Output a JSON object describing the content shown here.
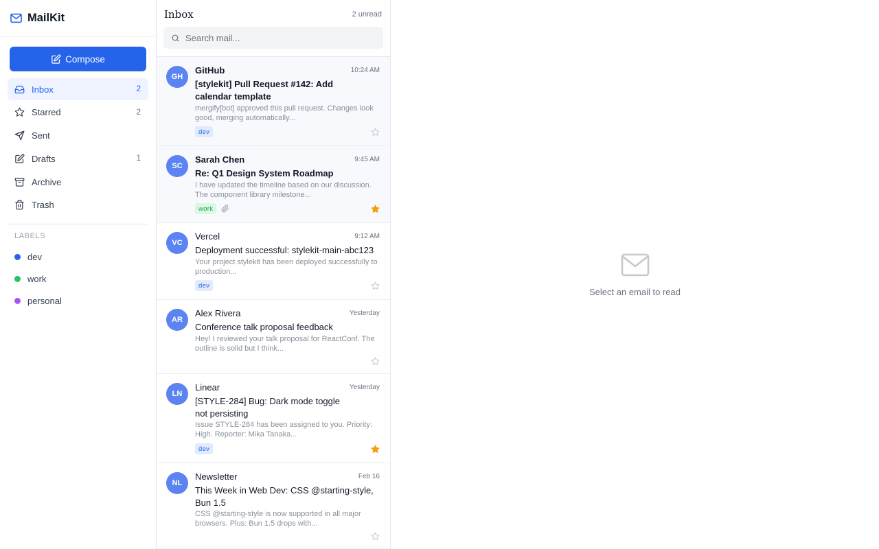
{
  "app": {
    "name": "MailKit"
  },
  "sidebar": {
    "compose_label": "Compose",
    "nav": [
      {
        "label": "Inbox",
        "count": "2",
        "icon": "inbox-icon",
        "active": true
      },
      {
        "label": "Starred",
        "count": "2",
        "icon": "star-icon"
      },
      {
        "label": "Sent",
        "count": "",
        "icon": "send-icon"
      },
      {
        "label": "Drafts",
        "count": "1",
        "icon": "pencil-icon"
      },
      {
        "label": "Archive",
        "count": "",
        "icon": "archive-icon"
      },
      {
        "label": "Trash",
        "count": "",
        "icon": "trash-icon"
      }
    ],
    "labels_title": "LABELS",
    "labels": [
      {
        "name": "dev",
        "color": "#2563eb"
      },
      {
        "name": "work",
        "color": "#22c55e"
      },
      {
        "name": "personal",
        "color": "#a855f7"
      }
    ]
  },
  "list": {
    "title": "Inbox",
    "unread_text": "2 unread",
    "search_placeholder": "Search mail...",
    "emails": [
      {
        "initials": "GH",
        "sender": "GitHub",
        "time": "10:24 AM",
        "subject": "[stylekit] Pull Request #142: Add calendar template",
        "preview": "mergify[bot] approved this pull request. Changes look good, merging automatically...",
        "tag": "dev",
        "starred": false,
        "unread": true,
        "attachment": false
      },
      {
        "initials": "SC",
        "sender": "Sarah Chen",
        "time": "9:45 AM",
        "subject": "Re: Q1 Design System Roadmap",
        "preview": "I have updated the timeline based on our discussion. The component library milestone...",
        "tag": "work",
        "starred": true,
        "unread": true,
        "attachment": true
      },
      {
        "initials": "VC",
        "sender": "Vercel",
        "time": "9:12 AM",
        "subject": "Deployment successful: stylekit-main-abc123",
        "preview": "Your project stylekit has been deployed successfully to production...",
        "tag": "dev",
        "starred": false,
        "unread": false,
        "attachment": false
      },
      {
        "initials": "AR",
        "sender": "Alex Rivera",
        "time": "Yesterday",
        "subject": "Conference talk proposal feedback",
        "preview": "Hey! I reviewed your talk proposal for ReactConf. The outline is solid but I think...",
        "tag": "",
        "starred": false,
        "unread": false,
        "attachment": false
      },
      {
        "initials": "LN",
        "sender": "Linear",
        "time": "Yesterday",
        "subject": "[STYLE-284] Bug: Dark mode toggle not persisting",
        "preview": "Issue STYLE-284 has been assigned to you. Priority: High. Reporter: Mika Tanaka...",
        "tag": "dev",
        "starred": true,
        "unread": false,
        "attachment": false
      },
      {
        "initials": "NL",
        "sender": "Newsletter",
        "time": "Feb 16",
        "subject": "This Week in Web Dev: CSS @starting-style, Bun 1.5",
        "preview": "CSS @starting-style is now supported in all major browsers. Plus: Bun 1.5 drops with...",
        "tag": "",
        "starred": false,
        "unread": false,
        "attachment": false
      }
    ]
  },
  "reader": {
    "empty_text": "Select an email to read",
    "icon": "mail-icon"
  },
  "colors": {
    "accent": "#2563eb",
    "star": "#f59e0b"
  }
}
